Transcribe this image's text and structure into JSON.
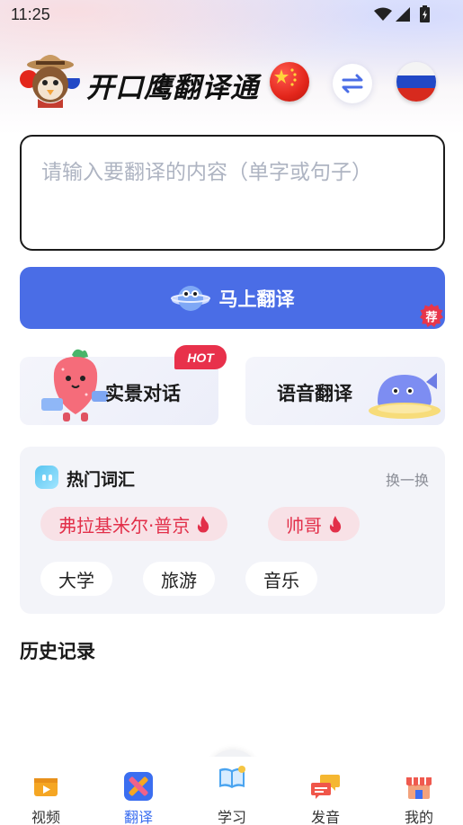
{
  "status_bar": {
    "time": "11:25"
  },
  "header": {
    "app_title": "开口鹰翻译通",
    "source_language_flag": "flag-china-icon",
    "target_language_flag": "flag-russia-icon"
  },
  "translate_input": {
    "placeholder": "请输入要翻译的内容（单字或句子）",
    "value": ""
  },
  "translate_button": {
    "label": "马上翻译",
    "badge": "荐"
  },
  "features": [
    {
      "label": "实景对话",
      "badge": "HOT"
    },
    {
      "label": "语音翻译"
    }
  ],
  "hot_words": {
    "title": "热门词汇",
    "refresh_label": "换一换",
    "items": [
      {
        "text": "弗拉基米尔·普京",
        "hot": true
      },
      {
        "text": "帅哥",
        "hot": true
      },
      {
        "text": "大学",
        "hot": false
      },
      {
        "text": "旅游",
        "hot": false
      },
      {
        "text": "音乐",
        "hot": false
      }
    ]
  },
  "history": {
    "title": "历史记录"
  },
  "bottom_nav": {
    "active": "翻译",
    "items": [
      {
        "label": "视频",
        "icon": "video-icon"
      },
      {
        "label": "翻译",
        "icon": "translate-icon"
      },
      {
        "label": "学习",
        "icon": "book-icon"
      },
      {
        "label": "发音",
        "icon": "chat-bubbles-icon"
      },
      {
        "label": "我的",
        "icon": "store-icon"
      }
    ]
  },
  "colors": {
    "primary": "#4a6de6",
    "hot_red": "#e22f49",
    "nav_active": "#3b6ef0"
  }
}
